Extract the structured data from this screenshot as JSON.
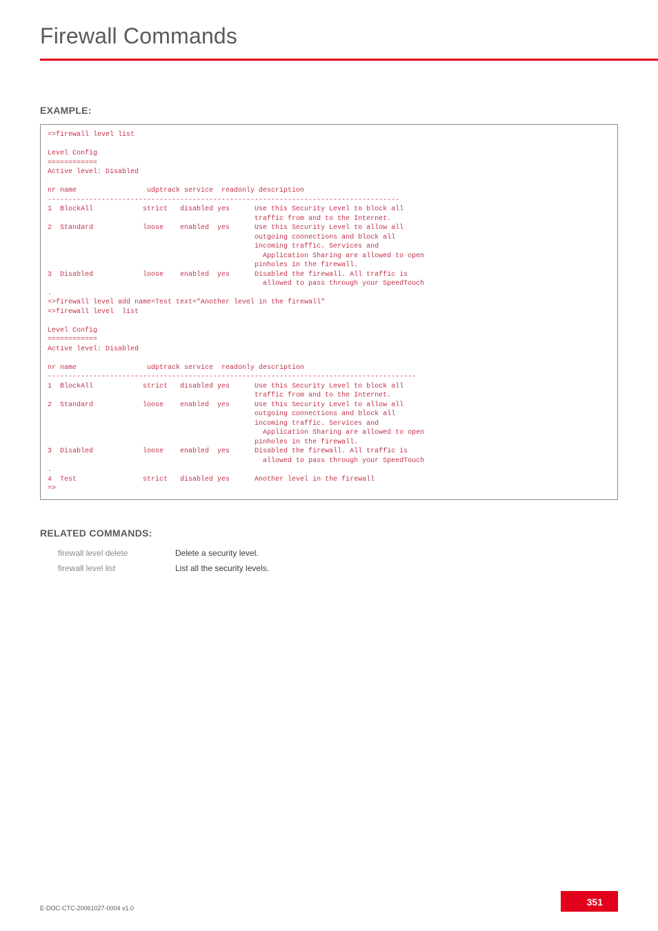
{
  "page_title": "Firewall Commands",
  "example_label": "EXAMPLE:",
  "terminal": {
    "cmd1": "=>firewall level list",
    "config_header": "Level Config",
    "config_sep": "============",
    "active_line": "Active level: Disabled",
    "table_header": "nr name                 udptrack service  readonly description",
    "dash1": "-------------------------------------------------------------------------------------",
    "rows1": [
      {
        "nr": "1",
        "name": "BlockAll",
        "udp": "strict",
        "svc": "disabled",
        "ro": "yes",
        "desc": [
          "Use this Security Level to block all",
          "traffic from and to the Internet."
        ]
      },
      {
        "nr": "2",
        "name": "Standard",
        "udp": "loose",
        "svc": "enabled",
        "ro": "yes",
        "desc": [
          "Use this Security Level to allow all",
          "outgoing connections and block all",
          "incoming traffic. Services and",
          "  Application Sharing are allowed to open",
          "pinholes in the firewall."
        ]
      },
      {
        "nr": "3",
        "name": "Disabled",
        "udp": "loose",
        "svc": "enabled",
        "ro": "yes",
        "desc": [
          "Disabled the firewall. All traffic is",
          "  allowed to pass through your SpeedTouch"
        ]
      }
    ],
    "dot": ".",
    "cmd2": "=>firewall level add name=Test text=\"Another level in the firewall\"",
    "cmd3": "=>firewall level  list",
    "dash2": "-----------------------------------------------------------------------------------------",
    "rows2_extra": {
      "nr": "4",
      "name": "Test",
      "udp": "strict",
      "svc": "disabled",
      "ro": "yes",
      "desc": [
        "Another level in the firewall"
      ]
    },
    "prompt": "=>"
  },
  "related_label": "RELATED COMMANDS:",
  "related": [
    {
      "cmd": "firewall level delete",
      "desc": "Delete a security level."
    },
    {
      "cmd": "firewall level list",
      "desc": "List all the security levels."
    }
  ],
  "footer": {
    "doc_id": "E-DOC-CTC-20061027-0004 v1.0",
    "page_num": "351"
  },
  "chart_data": {
    "type": "table",
    "title": "firewall level list output",
    "columns": [
      "nr",
      "name",
      "udptrack",
      "service",
      "readonly",
      "description"
    ],
    "rows": [
      [
        1,
        "BlockAll",
        "strict",
        "disabled",
        "yes",
        "Use this Security Level to block all traffic from and to the Internet."
      ],
      [
        2,
        "Standard",
        "loose",
        "enabled",
        "yes",
        "Use this Security Level to allow all outgoing connections and block all incoming traffic. Services and Application Sharing are allowed to open pinholes in the firewall."
      ],
      [
        3,
        "Disabled",
        "loose",
        "enabled",
        "yes",
        "Disabled the firewall. All traffic is allowed to pass through your SpeedTouch."
      ],
      [
        4,
        "Test",
        "strict",
        "disabled",
        "yes",
        "Another level in the firewall"
      ]
    ]
  }
}
